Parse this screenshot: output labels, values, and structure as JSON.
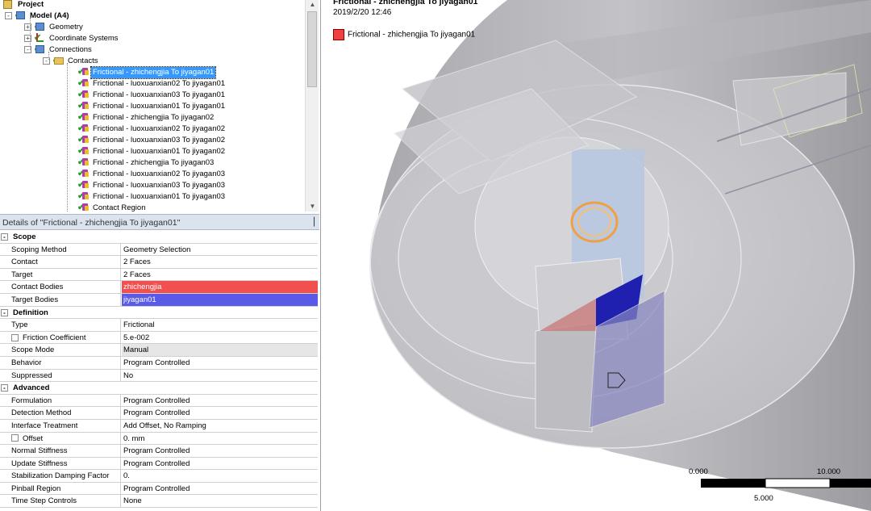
{
  "tree": {
    "project": "Project",
    "model": "Model (A4)",
    "geometry": "Geometry",
    "coordinate_systems": "Coordinate Systems",
    "connections": "Connections",
    "contacts": "Contacts",
    "contact_items": [
      "Frictional - zhichengjia To jiyagan01",
      "Frictional - luoxuanxian02 To jiyagan01",
      "Frictional - luoxuanxian03 To jiyagan01",
      "Frictional - luoxuanxian01 To jiyagan01",
      "Frictional - zhichengjia To jiyagan02",
      "Frictional - luoxuanxian02 To jiyagan02",
      "Frictional - luoxuanxian03 To jiyagan02",
      "Frictional - luoxuanxian01 To jiyagan02",
      "Frictional - zhichengjia To jiyagan03",
      "Frictional - luoxuanxian02 To jiyagan03",
      "Frictional - luoxuanxian03 To jiyagan03",
      "Frictional - luoxuanxian01 To jiyagan03",
      "Contact Region"
    ]
  },
  "details": {
    "title": "Details of \"Frictional - zhichengjia To jiyagan01\"",
    "pin": "▕",
    "rows": [
      {
        "type": "section",
        "key": "Scope"
      },
      {
        "key": "Scoping Method",
        "value": "Geometry Selection"
      },
      {
        "key": "Contact",
        "value": "2 Faces"
      },
      {
        "key": "Target",
        "value": "2 Faces"
      },
      {
        "key": "Contact Bodies",
        "value": "zhichengjia",
        "style": "red"
      },
      {
        "key": "Target Bodies",
        "value": "jiyagan01",
        "style": "blue"
      },
      {
        "type": "section",
        "key": "Definition"
      },
      {
        "key": "Type",
        "value": "Frictional"
      },
      {
        "key": "Friction Coefficient",
        "value": "5.e-002",
        "checkbox": true
      },
      {
        "key": "Scope Mode",
        "value": "Manual",
        "style": "gray"
      },
      {
        "key": "Behavior",
        "value": "Program Controlled"
      },
      {
        "key": "Suppressed",
        "value": "No"
      },
      {
        "type": "section",
        "key": "Advanced"
      },
      {
        "key": "Formulation",
        "value": "Program Controlled"
      },
      {
        "key": "Detection Method",
        "value": "Program Controlled"
      },
      {
        "key": "Interface Treatment",
        "value": "Add Offset, No Ramping"
      },
      {
        "key": "Offset",
        "value": "0. mm",
        "checkbox": true
      },
      {
        "key": "Normal Stiffness",
        "value": "Program Controlled"
      },
      {
        "key": "Update Stiffness",
        "value": "Program Controlled"
      },
      {
        "key": "Stabilization Damping Factor",
        "value": "0."
      },
      {
        "key": "Pinball Region",
        "value": "Program Controlled"
      },
      {
        "key": "Time Step Controls",
        "value": "None"
      }
    ]
  },
  "viewport": {
    "title": "Frictional - zhichengjia To jiyagan01",
    "date": "2019/2/20 12:46",
    "legend_label": "Frictional - zhichengjia To jiyagan01",
    "legend_color": "#f04040",
    "scale": {
      "left": "0.000",
      "right": "10.000",
      "mid": "5.000"
    }
  },
  "colors": {
    "selection": "#3399ff",
    "contact": "#f24f4f",
    "target": "#5a5ae8"
  }
}
